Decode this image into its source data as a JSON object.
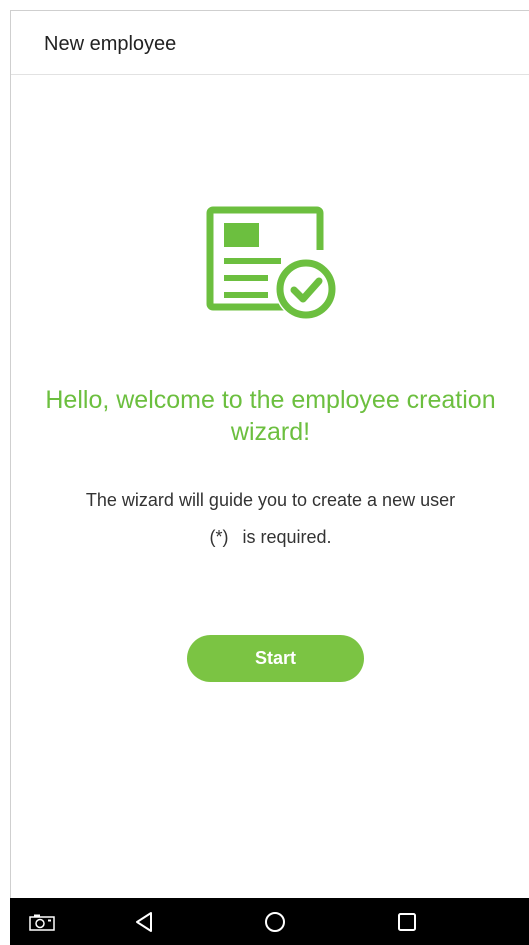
{
  "app_bar": {
    "title": "New employee"
  },
  "welcome": {
    "heading": "Hello, welcome to the employee creation wizard!"
  },
  "guide": {
    "text": "The wizard will guide you to create a new user"
  },
  "required": {
    "mark": "(*)",
    "text": "is required."
  },
  "actions": {
    "start_label": "Start"
  },
  "nav": {
    "icons": [
      "screenshot-icon",
      "back-icon",
      "home-icon",
      "recents-icon"
    ]
  },
  "colors": {
    "accent": "#6cbf3f",
    "button": "#7bc443",
    "nav_background": "#000000"
  }
}
